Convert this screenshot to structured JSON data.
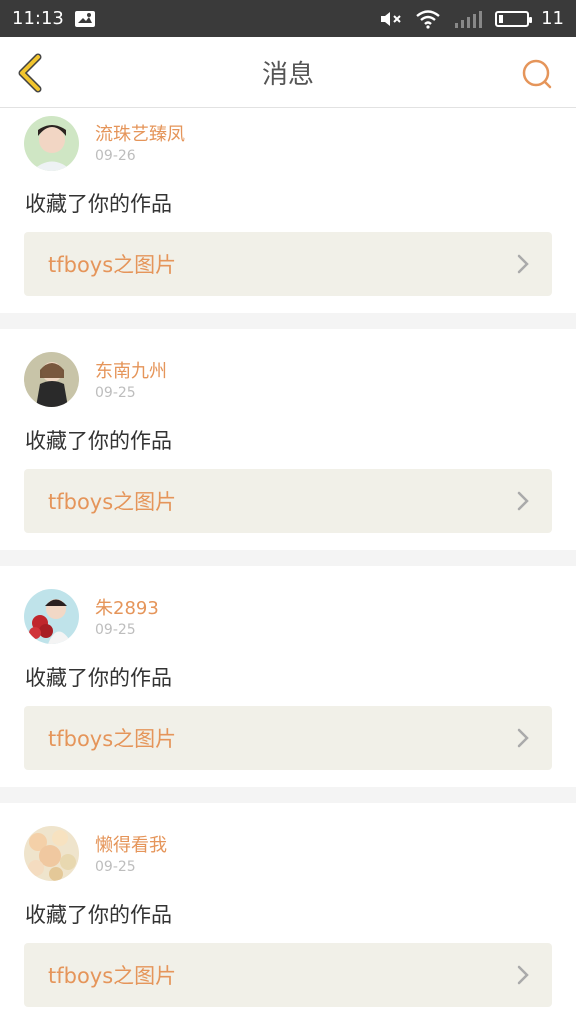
{
  "status_bar": {
    "time": "11:13",
    "battery_text": "11"
  },
  "nav": {
    "title": "消息"
  },
  "messages": [
    {
      "username": "流珠艺臻凤",
      "date": "09-26",
      "action": "收藏了你的作品",
      "link": "tfboys之图片"
    },
    {
      "username": "东南九州",
      "date": "09-25",
      "action": "收藏了你的作品",
      "link": "tfboys之图片"
    },
    {
      "username": "朱2893",
      "date": "09-25",
      "action": "收藏了你的作品",
      "link": "tfboys之图片"
    },
    {
      "username": "懒得看我",
      "date": "09-25",
      "action": "收藏了你的作品",
      "link": "tfboys之图片"
    }
  ],
  "colors": {
    "accent": "#e5955a",
    "back_arrow": "#f2c52e",
    "link_bg": "#f1f0e8"
  },
  "icons": [
    "back-arrow-icon",
    "search-icon",
    "chevron-right-icon",
    "mute-icon",
    "wifi-icon",
    "signal-icon",
    "battery-icon",
    "image-notification-icon"
  ]
}
